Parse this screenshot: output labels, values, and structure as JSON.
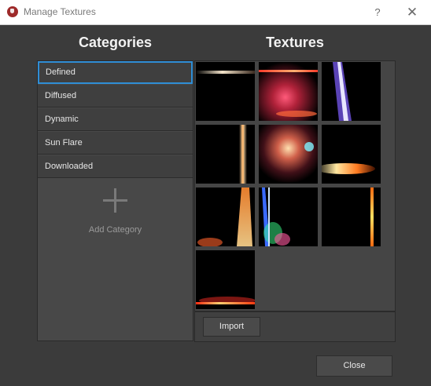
{
  "window": {
    "title": "Manage Textures",
    "help_glyph": "?",
    "close_glyph": "✕"
  },
  "categories": {
    "heading": "Categories",
    "items": [
      {
        "label": "Defined",
        "selected": true
      },
      {
        "label": "Diffused",
        "selected": false
      },
      {
        "label": "Dynamic",
        "selected": false
      },
      {
        "label": "Sun Flare",
        "selected": false
      },
      {
        "label": "Downloaded",
        "selected": false
      }
    ],
    "add_label": "Add Category",
    "add_icon": "plus-icon"
  },
  "textures": {
    "heading": "Textures",
    "tiles": [
      {
        "name": "streak-white-horizontal"
      },
      {
        "name": "flare-red-pink"
      },
      {
        "name": "streak-purple-diagonal"
      },
      {
        "name": "streak-orange-vertical"
      },
      {
        "name": "flare-orange-cyan"
      },
      {
        "name": "streak-orange-horizontal"
      },
      {
        "name": "flare-orange-vertical"
      },
      {
        "name": "streak-blue-green"
      },
      {
        "name": "streak-yellow-vertical"
      },
      {
        "name": "streak-red-horizontal-bottom"
      }
    ],
    "import_label": "Import"
  },
  "footer": {
    "close_label": "Close"
  },
  "colors": {
    "background": "#3b3b3b",
    "selection_accent": "#2f8ed6",
    "text": "#e6e6e6"
  }
}
